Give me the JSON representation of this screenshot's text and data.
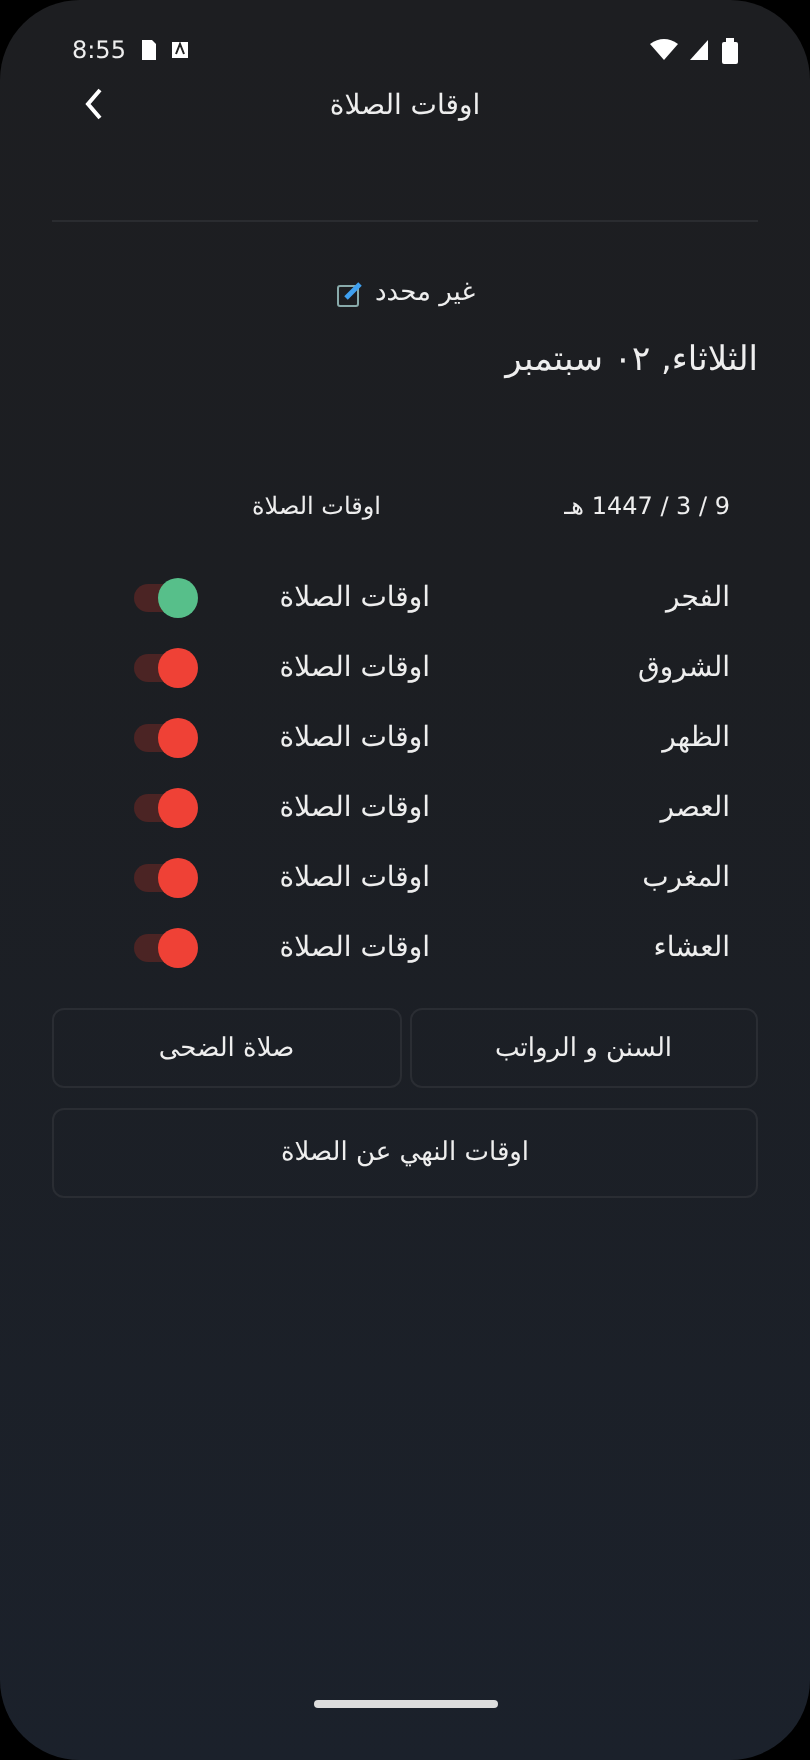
{
  "status_bar": {
    "time": "8:55"
  },
  "header": {
    "title": "اوقات الصلاة"
  },
  "location": {
    "label": "غير محدد"
  },
  "date": "الثلاثاء, ٠٢ سبتمبر",
  "hijri": {
    "date": "9 / 3 / 1447 هـ",
    "label": "اوقات الصلاة"
  },
  "prayers": [
    {
      "name": "الفجر",
      "time": "اوقات الصلاة",
      "color": "#57bf8a"
    },
    {
      "name": "الشروق",
      "time": "اوقات الصلاة",
      "color": "#ef4136"
    },
    {
      "name": "الظهر",
      "time": "اوقات الصلاة",
      "color": "#ef4136"
    },
    {
      "name": "العصر",
      "time": "اوقات الصلاة",
      "color": "#ef4136"
    },
    {
      "name": "المغرب",
      "time": "اوقات الصلاة",
      "color": "#ef4136"
    },
    {
      "name": "العشاء",
      "time": "اوقات الصلاة",
      "color": "#ef4136"
    }
  ],
  "buttons": [
    "السنن و الرواتب",
    "صلاة الضحى"
  ],
  "wide_button": "اوقات النهي عن الصلاة"
}
